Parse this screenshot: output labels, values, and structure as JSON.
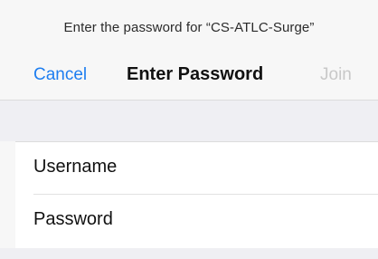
{
  "header": {
    "prompt": "Enter the password for “CS-ATLC-Surge”",
    "cancel_label": "Cancel",
    "title": "Enter Password",
    "join_label": "Join"
  },
  "form": {
    "username": {
      "label": "Username",
      "value": ""
    },
    "password": {
      "label": "Password",
      "value": ""
    }
  },
  "colors": {
    "accent": "#1e7ef0",
    "disabled": "#c8c8c8",
    "background": "#f7f7f7",
    "group_background": "#efeff3"
  }
}
